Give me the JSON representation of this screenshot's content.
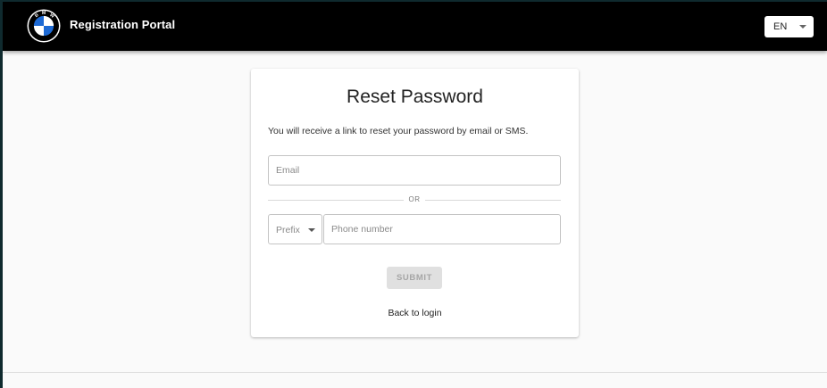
{
  "header": {
    "logo_alt": "BMW",
    "title": "Registration Portal",
    "language": {
      "selected": "EN"
    }
  },
  "card": {
    "title": "Reset Password",
    "description": "You will receive a link to reset your password by email or SMS.",
    "email": {
      "placeholder": "Email",
      "value": ""
    },
    "divider_text": "OR",
    "prefix": {
      "placeholder": "Prefix"
    },
    "phone": {
      "placeholder": "Phone number",
      "value": ""
    },
    "submit_label": "SUBMIT",
    "back_label": "Back to login"
  },
  "colors": {
    "header_bg": "#000000",
    "page_bg": "#fafafa",
    "card_bg": "#ffffff",
    "disabled_button_bg": "#e0e0e0",
    "disabled_button_text": "#a6a6a6",
    "bmw_blue": "#1c69d4"
  },
  "icons": {
    "logo": "bmw-roundel-logo",
    "language_caret": "caret-down-icon",
    "prefix_caret": "caret-down-icon"
  }
}
